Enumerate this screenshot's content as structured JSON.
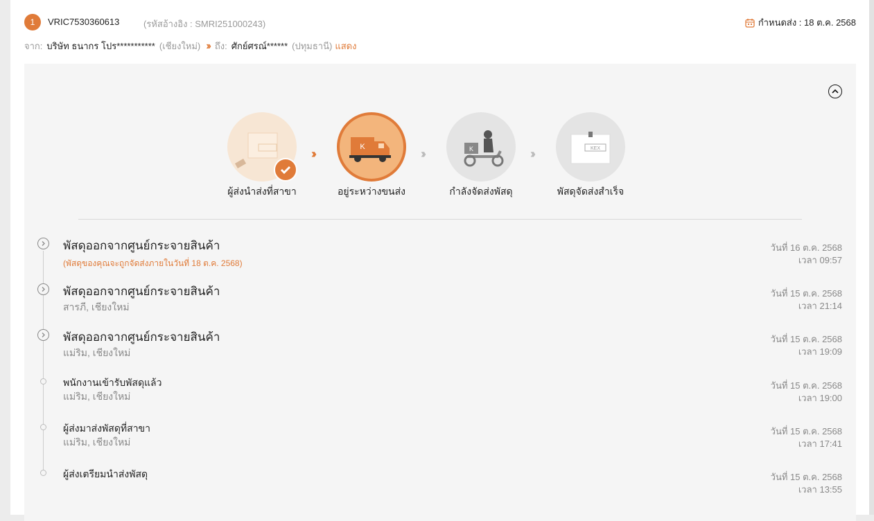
{
  "shipment": {
    "index": "1",
    "tracking_no": "VRIC7530360613",
    "ref_no": "(รหัสอ้างอิง : SMRI251000243)",
    "deadline": "กำหนดส่ง : 18 ต.ค. 2568"
  },
  "route": {
    "from_label": "จาก:",
    "from_name": "บริษัท ธนากร โปร***********",
    "from_place": "(เชียงใหม่)",
    "to_label": "ถึง:",
    "to_name": "ศักย์ศรณ์******",
    "to_place": "(ปทุมธานี)",
    "show_link": "แสดง"
  },
  "steps": [
    {
      "label": "ผู้ส่งนำส่งที่สาขา",
      "icon": "parcel-box-icon",
      "state": "done"
    },
    {
      "label": "อยู่ระหว่างขนส่ง",
      "icon": "delivery-truck-icon",
      "state": "current"
    },
    {
      "label": "กำลังจัดส่งพัสดุ",
      "icon": "scooter-rider-icon",
      "state": "pending"
    },
    {
      "label": "พัสดุจัดส่งสำเร็จ",
      "icon": "parcel-box-icon",
      "state": "pending"
    }
  ],
  "timeline": [
    {
      "title": "พัสดุออกจากศูนย์กระจายสินค้า",
      "sub": "(พัสดุของคุณจะถูกจัดส่งภายในวันที่ 18 ต.ค. 2568)",
      "date": "วันที่ 16 ต.ค. 2568",
      "time": "เวลา 09:57"
    },
    {
      "title": "พัสดุออกจากศูนย์กระจายสินค้า",
      "sub": "สารภี, เชียงใหม่",
      "date": "วันที่ 15 ต.ค. 2568",
      "time": "เวลา 21:14"
    },
    {
      "title": "พัสดุออกจากศูนย์กระจายสินค้า",
      "sub": "แม่ริม, เชียงใหม่",
      "date": "วันที่ 15 ต.ค. 2568",
      "time": "เวลา 19:09"
    },
    {
      "title": "พนักงานเข้ารับพัสดุแล้ว",
      "sub": "แม่ริม, เชียงใหม่",
      "date": "วันที่ 15 ต.ค. 2568",
      "time": "เวลา 19:00"
    },
    {
      "title": "ผู้ส่งมาส่งพัสดุที่สาขา",
      "sub": "แม่ริม, เชียงใหม่",
      "date": "วันที่ 15 ต.ค. 2568",
      "time": "เวลา 17:41"
    },
    {
      "title": "ผู้ส่งเตรียมนำส่งพัสดุ",
      "sub": "",
      "date": "วันที่ 15 ต.ค. 2568",
      "time": "เวลา 13:55"
    }
  ],
  "colors": {
    "accent": "#e07b39",
    "panel": "#f5f5f5",
    "muted": "#888888"
  }
}
